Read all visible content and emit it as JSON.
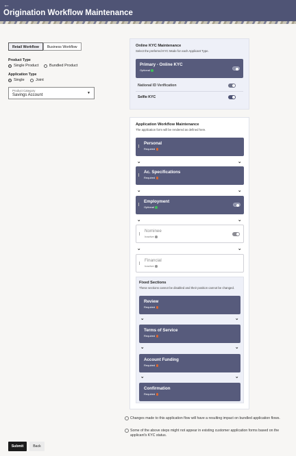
{
  "header": {
    "back_glyph": "←",
    "title": "Origination Workflow Maintenance"
  },
  "tabs": [
    {
      "label": "Retail Workflow",
      "selected": true
    },
    {
      "label": "Business Workflow",
      "selected": false
    }
  ],
  "product_type": {
    "label": "Product Type",
    "options": [
      {
        "label": "Single Product",
        "selected": true
      },
      {
        "label": "Bundled Product",
        "selected": false
      }
    ]
  },
  "application_type": {
    "label": "Application Type",
    "options": [
      {
        "label": "Single",
        "selected": true
      },
      {
        "label": "Joint",
        "selected": false
      }
    ]
  },
  "product_category": {
    "label": "Product Category",
    "value": "Savings Account"
  },
  "kyc": {
    "title": "Online KYC Maintenance",
    "subtitle": "Select the preferred KYC Mode for each Applicant Type.",
    "primary": {
      "title": "Primary - Online KYC",
      "status": "Optional",
      "status_color": "#3fbf5a"
    },
    "rows": [
      {
        "label": "National ID Verification",
        "on": false
      },
      {
        "label": "Selfie KYC",
        "on": true
      }
    ]
  },
  "workflow": {
    "title": "Application Workflow Maintenance",
    "subtitle": "The application form will be rendered as defined here.",
    "steps": [
      {
        "title": "Personal",
        "status": "Required",
        "status_color": "#e0672d",
        "active": true,
        "toggle": false
      },
      {
        "title": "Ac. Specifications",
        "status": "Required",
        "status_color": "#e0672d",
        "active": true,
        "toggle": false
      },
      {
        "title": "Employment",
        "status": "Optional",
        "status_color": "#3fbf5a",
        "active": true,
        "toggle": true
      },
      {
        "title": "Nominee",
        "status": "Inactive",
        "status_color": "#999999",
        "active": false,
        "toggle": true
      },
      {
        "title": "Financial",
        "status": "Inactive",
        "status_color": "#999999",
        "active": false,
        "toggle": false
      }
    ]
  },
  "fixed": {
    "title": "Fixed Sections",
    "subtitle": "These sections cannot be disabled and their position cannot be changed.",
    "steps": [
      {
        "title": "Review",
        "status": "Required",
        "status_color": "#e0672d"
      },
      {
        "title": "Terms of Service",
        "status": "Required",
        "status_color": "#e0672d"
      },
      {
        "title": "Account Funding",
        "status": "Required",
        "status_color": "#e0672d"
      },
      {
        "title": "Confirmation",
        "status": "Required",
        "status_color": "#e0672d"
      }
    ]
  },
  "notes": [
    "Changes made to this application flow will have a resulting impact on bundled application flows.",
    "Some of the above steps might not appear in existing customer application forms based on the applicant's KYC status."
  ],
  "arrow_glyph": "⌄",
  "buttons": {
    "submit": "Submit",
    "back": "Back"
  }
}
